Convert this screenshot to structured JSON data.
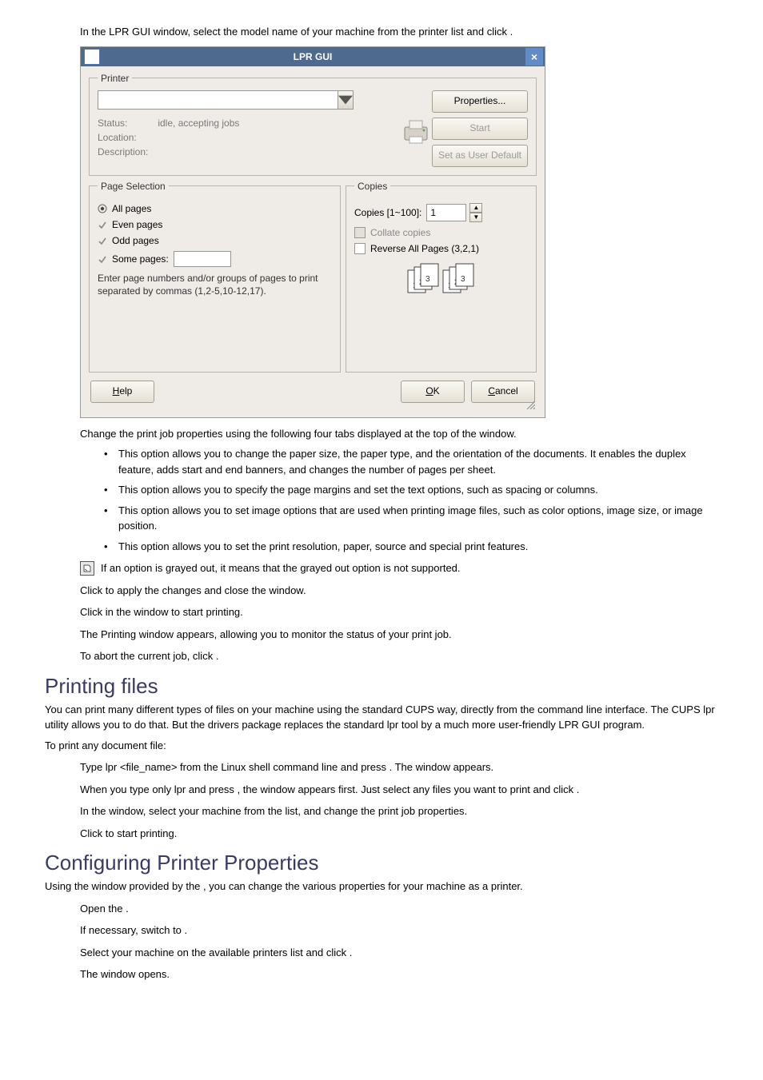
{
  "step3": {
    "text_a": "In the LPR GUI window, select the model name of your machine from the printer list and click ",
    "text_b": "."
  },
  "window": {
    "title": "LPR GUI",
    "close": "×",
    "printer": {
      "legend": "Printer",
      "status_label": "Status:",
      "status_value": "idle, accepting jobs",
      "location_label": "Location:",
      "description_label": "Description:",
      "btn_properties": "Properties...",
      "btn_start": "Start",
      "btn_setdefault": "Set as User Default"
    },
    "page_selection": {
      "legend": "Page Selection",
      "all": "All pages",
      "even": "Even pages",
      "odd": "Odd pages",
      "some": "Some pages:",
      "hint": "Enter page numbers and/or groups of pages to print separated by commas (1,2-5,10-12,17)."
    },
    "copies": {
      "legend": "Copies",
      "copies_label": "Copies [1~100]:",
      "copies_value": "1",
      "collate": "Collate copies",
      "reverse": "Reverse All Pages (3,2,1)"
    },
    "help_btn": "Help",
    "ok_btn": "OK",
    "cancel_btn": "Cancel"
  },
  "step4": {
    "lead": "Change the print job properties using the following four tabs displayed at the top of the window.",
    "items": [
      " This option allows you to change the paper size, the paper type, and the orientation of the documents. It enables the duplex feature, adds start and end banners, and changes the number of pages per sheet.",
      " This option allows you to specify the page margins and set the text options, such as spacing or columns.",
      " This option allows you to set image options that are used when printing image files, such as color options, image size, or image position.",
      " This option allows you to set the print resolution, paper, source and special print features."
    ],
    "note": "If an option is grayed out, it means that the grayed out option is not supported."
  },
  "step5": {
    "a": "Click ",
    "b": " to apply the changes and close the ",
    "c": " window."
  },
  "step6": {
    "a": "Click ",
    "b": " in the ",
    "c": " window to start printing."
  },
  "step6_2": "The Printing window appears, allowing you to monitor the status of your print job.",
  "step6_3": {
    "a": "To abort the current job, click ",
    "b": "."
  },
  "printing_files": {
    "heading": "Printing files",
    "intro": "You can print many different types of files on your machine using the standard CUPS way, directly from the command line interface. The CUPS lpr utility allows you to do that. But the drivers package replaces the standard lpr tool by a much more user-friendly LPR GUI program.",
    "intro2": "To print any document file:",
    "s1": {
      "a": "Type lpr <file_name> from the Linux shell command line and press ",
      "b": ". The ",
      "c": " window appears."
    },
    "s1b": {
      "a": "When you type only lpr and press ",
      "b": ", the ",
      "c": " window appears first. Just select any files you want to print and click ",
      "d": "."
    },
    "s2": {
      "a": "In the ",
      "b": " window, select your machine from the list, and change the print job properties."
    },
    "s3": {
      "a": "Click ",
      "b": " to start printing."
    }
  },
  "config_props": {
    "heading": "Configuring Printer Properties",
    "intro": {
      "a": "Using the ",
      "b": " window provided by the ",
      "c": ", you can change the various properties for your machine as a printer."
    },
    "s1": {
      "a": "Open the ",
      "b": "."
    },
    "s1b": {
      "a": "If necessary, switch to ",
      "b": "."
    },
    "s2": {
      "a": "Select your machine on the available printers list and click ",
      "b": "."
    },
    "s3": {
      "a": "The ",
      "b": " window opens."
    }
  }
}
